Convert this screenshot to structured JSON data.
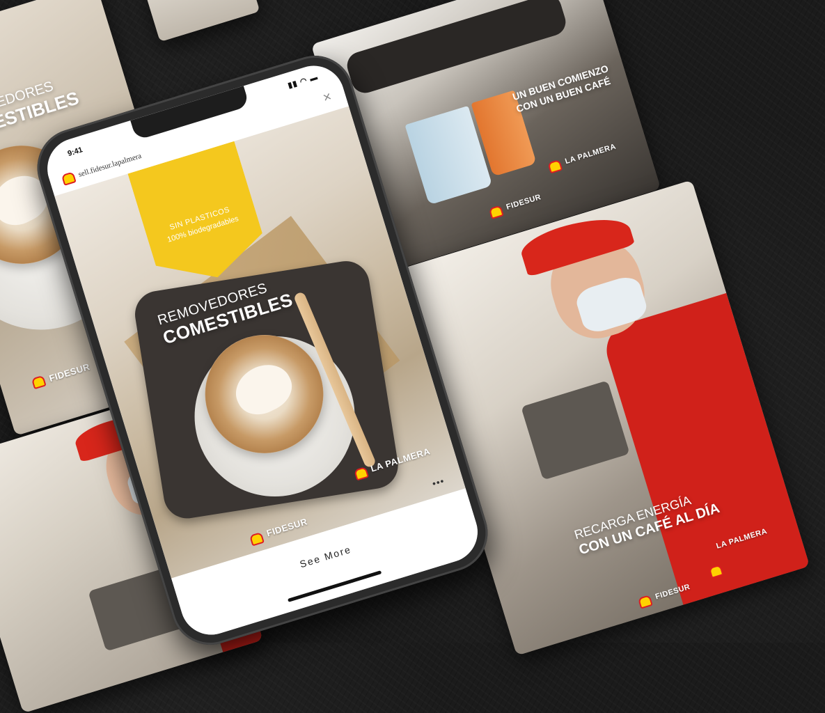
{
  "phone": {
    "status_time": "9:41",
    "status_icons": "▮▮ ◠ ▬",
    "header_url": "sell.fidesur.lapalmera",
    "close_glyph": "×",
    "yellow_tab_line1": "SIN PLASTICOS",
    "yellow_tab_line2": "100% biodegradables",
    "headline_line1": "REMOVEDORES",
    "headline_line2": "COMESTIBLES",
    "brand_fidesur": "FIDESUR",
    "brand_palmera": "LA PALMERA",
    "more_glyph": "•••",
    "see_more_label": "See More"
  },
  "card_left": {
    "headline_line1": "REMOVEDORES",
    "headline_line2": "COMESTIBLES",
    "brand_fidesur": "FIDESUR"
  },
  "card_top_right": {
    "headline_line1": "UN BUEN COMIENZO",
    "headline_line2": "CON UN BUEN CAFÉ",
    "brand_fidesur": "FIDESUR",
    "brand_palmera": "LA PALMERA"
  },
  "card_right": {
    "headline_line1": "RECARGA ENERGÍA",
    "headline_line2": "CON UN CAFÉ AL DÍA",
    "brand_fidesur": "FIDESUR",
    "brand_palmera": "LA PALMERA"
  },
  "colors": {
    "shell_yellow": "#ffd200",
    "shell_red": "#dd1d21",
    "tab_yellow": "#f4c81e",
    "background": "#1b1b1b"
  }
}
